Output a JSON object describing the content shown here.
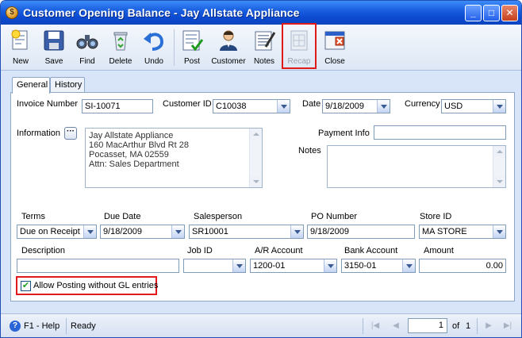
{
  "window": {
    "title": "Customer Opening Balance - Jay Allstate Appliance"
  },
  "titlebar_buttons": {
    "minimize": "_",
    "maximize": "□",
    "close": "✕"
  },
  "toolbar": {
    "new": "New",
    "save": "Save",
    "find": "Find",
    "delete": "Delete",
    "undo": "Undo",
    "post": "Post",
    "customer": "Customer",
    "notes": "Notes",
    "recap": "Recap",
    "close": "Close"
  },
  "tabs": {
    "general": "General",
    "history": "History"
  },
  "form": {
    "invoice_number_label": "Invoice Number",
    "invoice_number": "SI-10071",
    "customer_id_label": "Customer ID",
    "customer_id": "C10038",
    "date_label": "Date",
    "date": "9/18/2009",
    "currency_label": "Currency",
    "currency": "USD",
    "information_label": "Information",
    "information_btn": "···",
    "information_lines": [
      "Jay Allstate Appliance",
      "160 MacArthur Blvd Rt 28",
      "Pocasset, MA 02559",
      "Attn: Sales Department"
    ],
    "payment_info_label": "Payment Info",
    "payment_info": "",
    "notes_label": "Notes",
    "notes": "",
    "terms_label": "Terms",
    "terms": "Due on Receipt",
    "due_date_label": "Due Date",
    "due_date": "9/18/2009",
    "salesperson_label": "Salesperson",
    "salesperson": "SR10001",
    "po_number_label": "PO Number",
    "po_number": "9/18/2009",
    "store_id_label": "Store ID",
    "store_id": "MA STORE",
    "description_label": "Description",
    "description": "",
    "job_id_label": "Job ID",
    "job_id": "",
    "ar_account_label": "A/R Account",
    "ar_account": "1200-01",
    "bank_account_label": "Bank Account",
    "bank_account": "3150-01",
    "amount_label": "Amount",
    "amount": "0.00",
    "allow_posting_label": "Allow Posting without GL entries",
    "allow_posting_checked": true
  },
  "status": {
    "help": "F1 - Help",
    "ready": "Ready",
    "page": "1",
    "of_label": "of",
    "total_pages": "1"
  },
  "colors": {
    "highlight": "#e01a1a",
    "title_bar": "#0b4ad1",
    "field_border": "#7f9db9"
  }
}
